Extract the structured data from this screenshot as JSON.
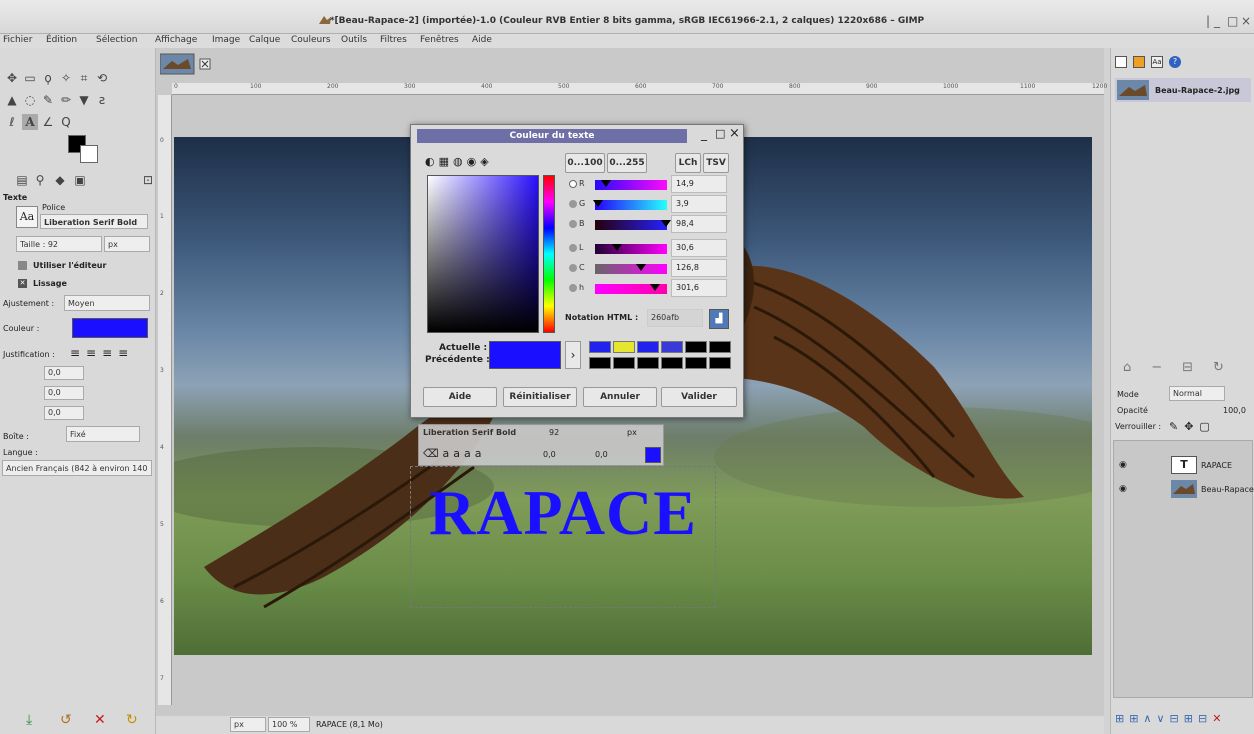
{
  "window": {
    "title": "*[Beau-Rapace-2] (importée)-1.0 (Couleur RVB Entier 8 bits gamma, sRGB IEC61966-2.1, 2 calques) 1220x686 – GIMP",
    "controls": [
      "|",
      "_",
      "□",
      "×"
    ]
  },
  "menu": [
    "Fichier",
    "Édition",
    "Sélection",
    "Affichage",
    "Image",
    "Calque",
    "Couleurs",
    "Outils",
    "Filtres",
    "Fenêtres",
    "Aide"
  ],
  "toolbox": {
    "section": "Texte",
    "font_label": "Police",
    "font_value": "Liberation Serif Bold",
    "size_label": "Taille : 92",
    "size_unit": "px",
    "use_editor": "Utiliser l'éditeur",
    "smoothing": "Lissage",
    "hinting_label": "Ajustement :",
    "hinting_value": "Moyen",
    "color_label": "Couleur :",
    "color_value": "#1a10ff",
    "justify_label": "Justification :",
    "indent_value": "0,0",
    "line_spacing_value": "0,0",
    "letter_spacing_value": "0,0",
    "box_label": "Boîte :",
    "box_value": "Fixé",
    "language_label": "Langue :",
    "language_value": "Ancien Français (842 à environ 140"
  },
  "ruler": {
    "ticks": [
      "0",
      "100",
      "200",
      "300",
      "400",
      "500",
      "600",
      "700",
      "800",
      "900",
      "1000",
      "1100",
      "1200"
    ]
  },
  "ruler_left": {
    "ticks": [
      "0",
      "1",
      "2",
      "3",
      "4",
      "5",
      "6",
      "7"
    ]
  },
  "canvas": {
    "text": "RAPACE",
    "text_toolbar": {
      "font": "Liberation Serif Bold",
      "size": "92",
      "unit": "px",
      "baseline": "0,0",
      "kerning": "0,0"
    }
  },
  "status": {
    "unit": "px",
    "zoom": "100 %",
    "info": "RAPACE (8,1 Mo)"
  },
  "dock": {
    "image_name": "Beau-Rapace-2.jpg",
    "mode_label": "Mode",
    "mode_value": "Normal",
    "opacity_label": "Opacité",
    "opacity_value": "100,0",
    "lock_label": "Verrouiller :",
    "layers": [
      "RAPACE",
      "Beau-Rapace-2"
    ]
  },
  "dialog": {
    "title": "Couleur du texte",
    "range_buttons": [
      "0...100",
      "0...255"
    ],
    "model_buttons": [
      "LCh",
      "TSV"
    ],
    "channels": [
      {
        "label": "R",
        "value": "14,9",
        "level": 0.149
      },
      {
        "label": "G",
        "value": "3,9",
        "level": 0.039
      },
      {
        "label": "B",
        "value": "98,4",
        "level": 0.984
      },
      {
        "label": "L",
        "value": "30,6",
        "level": 0.306
      },
      {
        "label": "C",
        "value": "126,8",
        "level": 0.634
      },
      {
        "label": "h",
        "value": "301,6",
        "level": 0.838
      }
    ],
    "html_label": "Notation HTML :",
    "html_value": "260afb",
    "current_label": "Actuelle :",
    "previous_label": "Précédente :",
    "history_colors": [
      "#2222ee",
      "#e6e630",
      "#2222ee",
      "#3a3ad8",
      "#000000",
      "#000000",
      "#000000",
      "#000000",
      "#000000",
      "#000000",
      "#000000",
      "#000000"
    ],
    "buttons": [
      "Aide",
      "Réinitialiser",
      "Annuler",
      "Valider"
    ]
  }
}
